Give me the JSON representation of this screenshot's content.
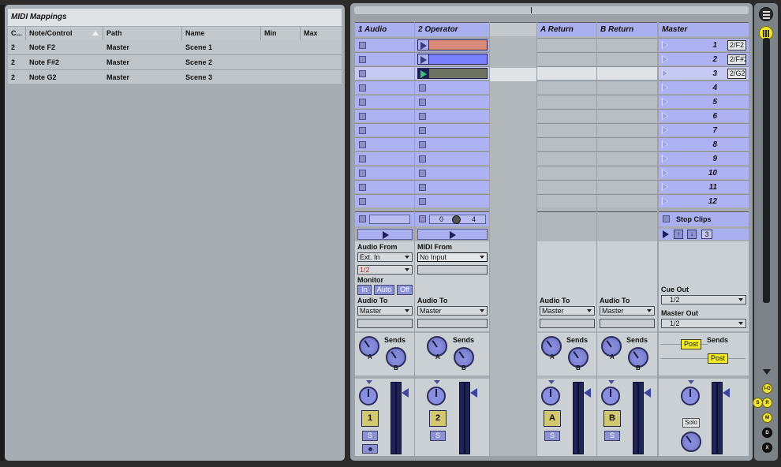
{
  "midi_mappings": {
    "title": "MIDI Mappings",
    "columns": [
      "C...",
      "Note/Control",
      "Path",
      "Name",
      "Min",
      "Max"
    ],
    "rows": [
      {
        "channel": "2",
        "note": "Note F2",
        "path": "Master",
        "name": "Scene 1",
        "min": "",
        "max": ""
      },
      {
        "channel": "2",
        "note": "Note F#2",
        "path": "Master",
        "name": "Scene 2",
        "min": "",
        "max": ""
      },
      {
        "channel": "2",
        "note": "Note G2",
        "path": "Master",
        "name": "Scene 3",
        "min": "",
        "max": ""
      }
    ]
  },
  "tracks": {
    "audio": {
      "name": "1 Audio",
      "input_label": "Audio From",
      "input_value": "Ext. In",
      "input_channel": "1/2",
      "monitor_label": "Monitor",
      "monitor_options": [
        "In",
        "Auto",
        "Off"
      ],
      "output_label": "Audio To",
      "output_value": "Master",
      "sends_label": "Sends",
      "send_a": "A",
      "send_b": "B",
      "track_number": "1",
      "solo": "S"
    },
    "operator": {
      "name": "2 Operator",
      "input_label": "MIDI From",
      "input_value": "No Input",
      "output_label": "Audio To",
      "output_value": "Master",
      "sends_label": "Sends",
      "send_a": "A",
      "send_b": "B",
      "track_number": "2",
      "solo": "S",
      "counter_left": "0",
      "counter_right": "4",
      "clip_colors": [
        "#d98a78",
        "#7b80ff",
        "#6e7260"
      ]
    },
    "return_a": {
      "name": "A Return",
      "output_label": "Audio To",
      "output_value": "Master",
      "sends_label": "Sends",
      "send_a": "A",
      "send_b": "B",
      "track_letter": "A",
      "solo": "S"
    },
    "return_b": {
      "name": "B Return",
      "output_label": "Audio To",
      "output_value": "Master",
      "sends_label": "Sends",
      "send_a": "A",
      "send_b": "B",
      "track_letter": "B",
      "solo": "S"
    },
    "master": {
      "name": "Master",
      "scenes": [
        "1",
        "2",
        "3",
        "4",
        "5",
        "6",
        "7",
        "8",
        "9",
        "10",
        "11",
        "12"
      ],
      "scene_mappings": [
        "2/F2",
        "2/F#2",
        "2/G2"
      ],
      "stop_clips": "Stop Clips",
      "scene_index": "3",
      "cue_out_label": "Cue Out",
      "cue_out_value": "1/2",
      "master_out_label": "Master Out",
      "master_out_value": "1/2",
      "sends_label": "Sends",
      "post_1": "Post",
      "post_2": "Post",
      "solo": "Solo"
    }
  },
  "strip": {
    "buttons": [
      "I-O",
      "S",
      "R",
      "M",
      "D",
      "X"
    ]
  },
  "colors": {
    "track_header": "#a9afef",
    "slot_bg": "#aeb2f2",
    "return_slot": "#b9bec3",
    "meter": "#1f2355",
    "yellow_button": "#f3ec2d"
  }
}
